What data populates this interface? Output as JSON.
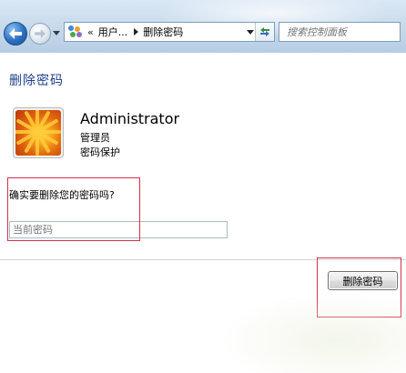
{
  "nav": {
    "address": {
      "prefix": "«",
      "crumb1": "用户...",
      "crumb2": "删除密码"
    },
    "search": {
      "placeholder": "搜索控制面板"
    }
  },
  "main": {
    "title": "删除密码",
    "user": {
      "name": "Administrator",
      "role": "管理员",
      "status": "密码保护"
    },
    "question": "确实要删除您的密码吗?",
    "password_field": {
      "placeholder": "当前密码",
      "value": ""
    },
    "delete_button": "删除密码"
  },
  "colors": {
    "title": "#1e3f8a",
    "highlight": "#d6304a",
    "navbar": "#c9dced"
  }
}
